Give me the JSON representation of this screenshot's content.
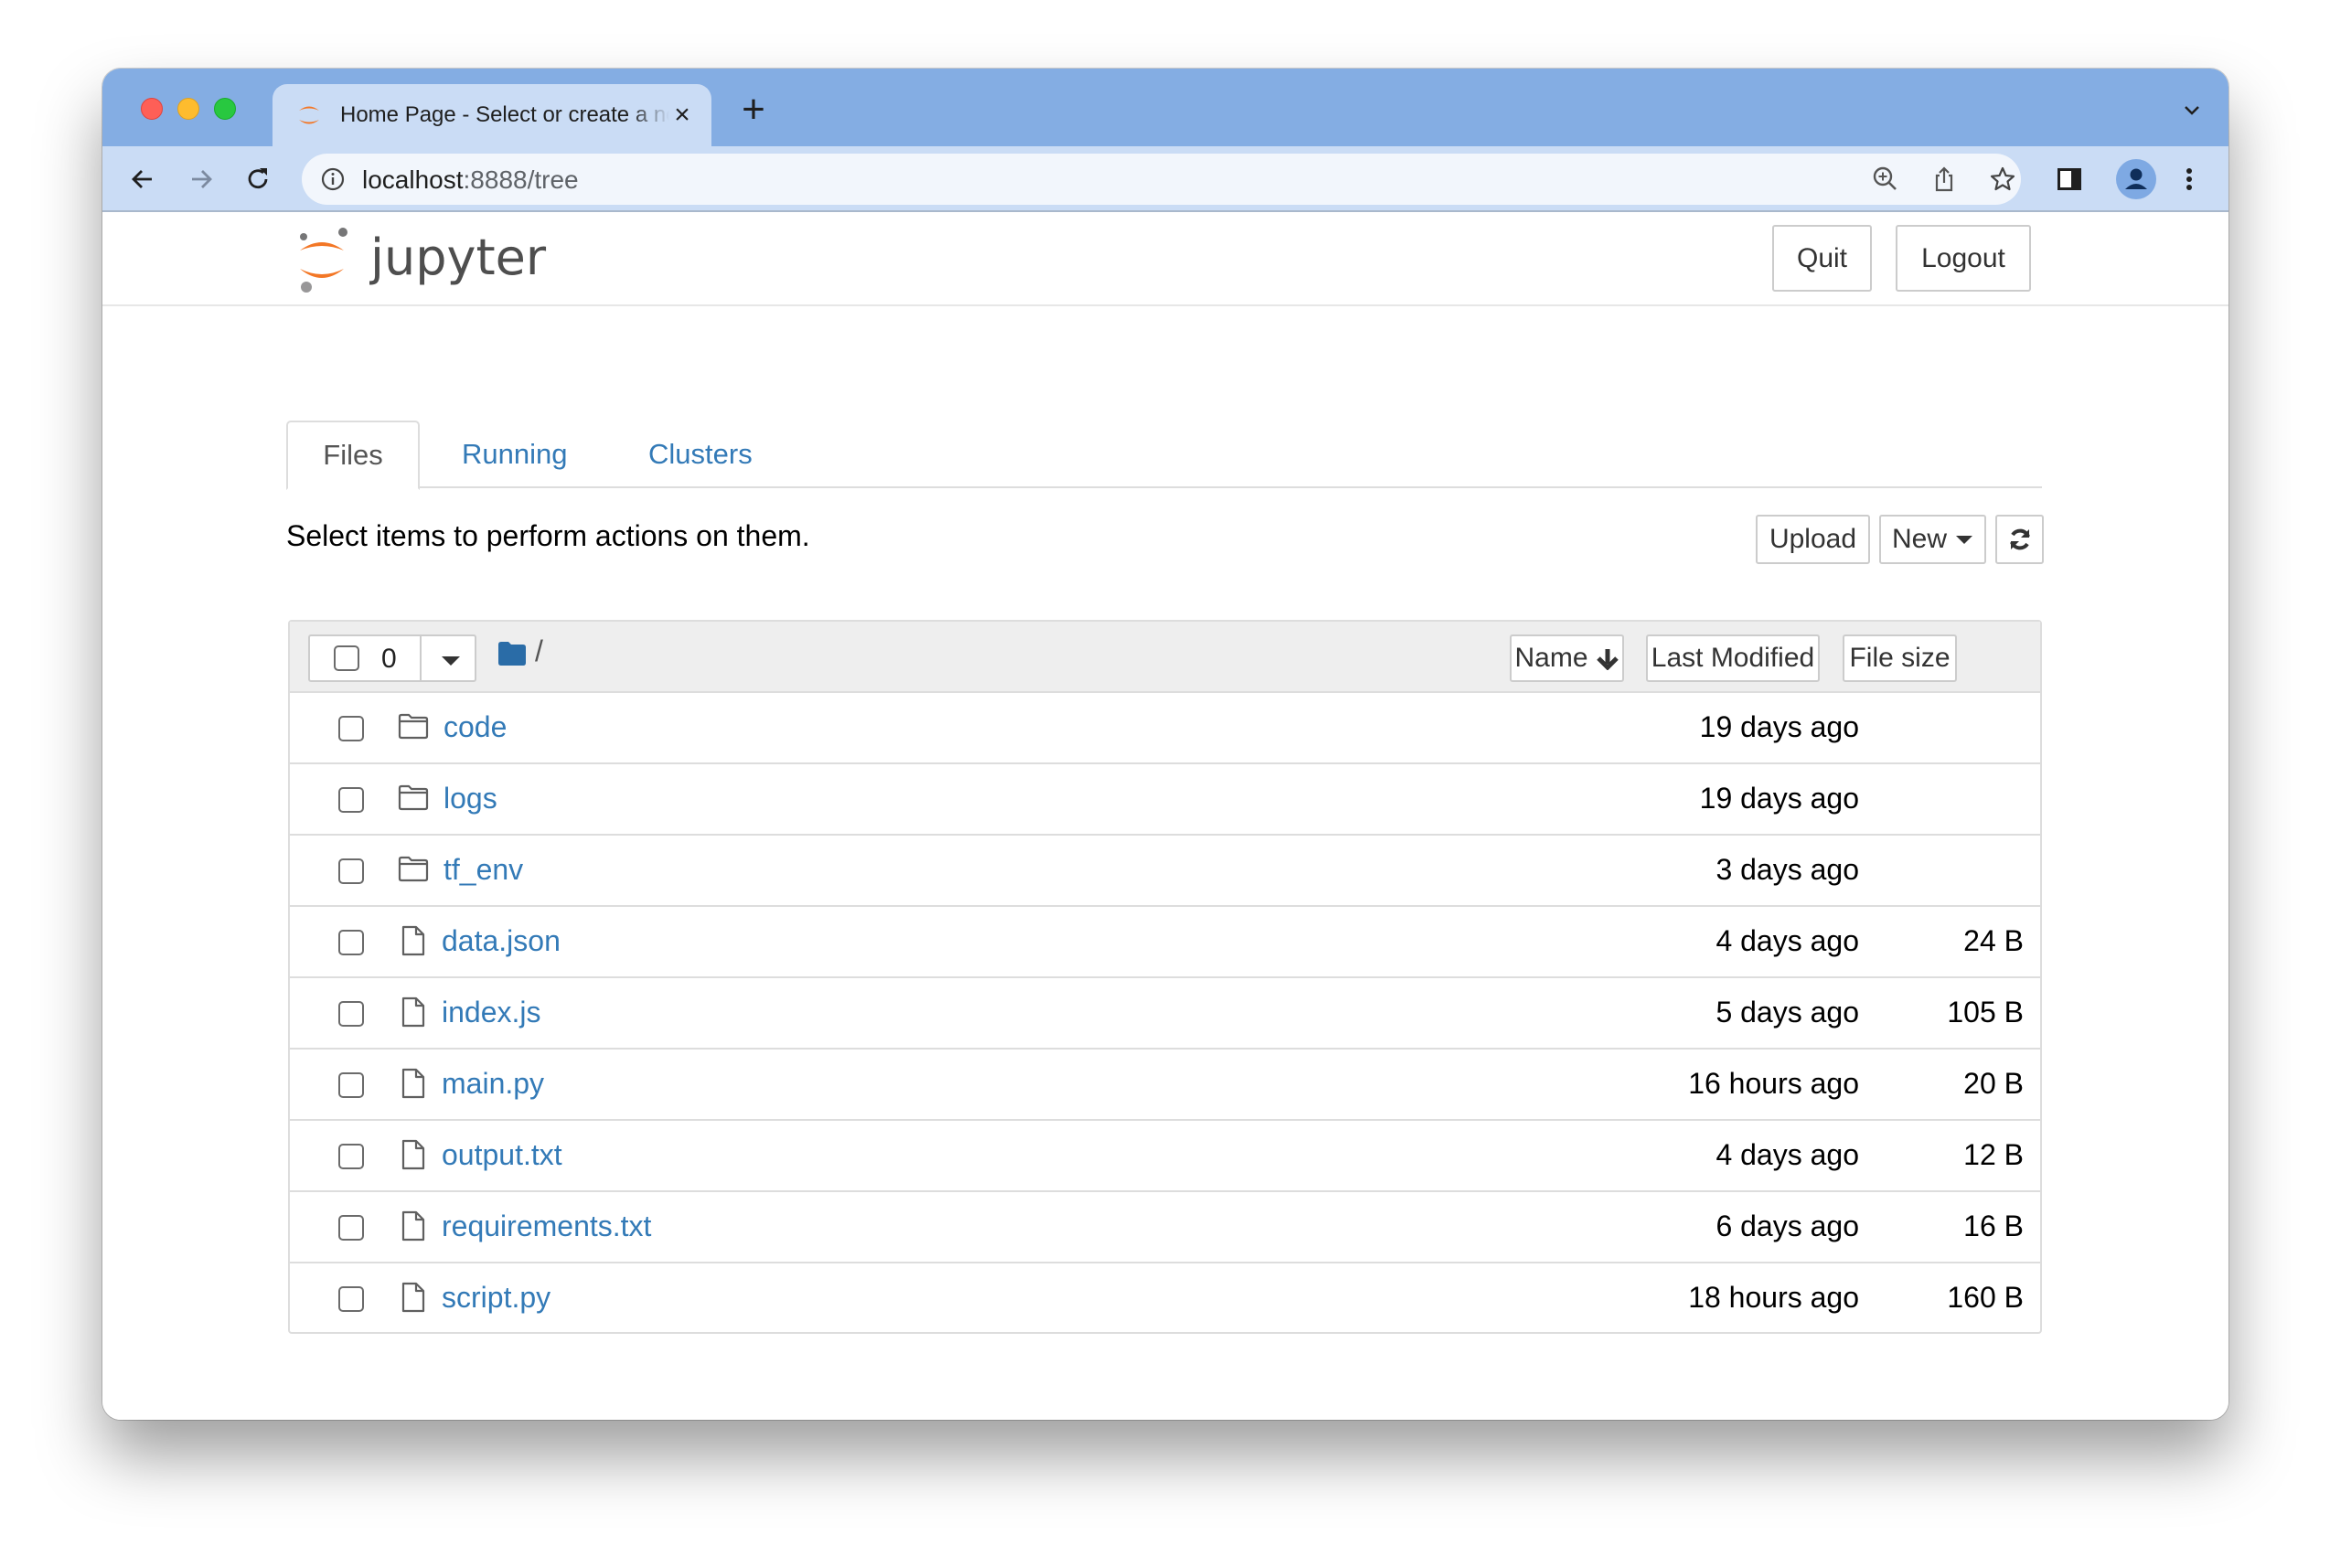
{
  "browser": {
    "tab": {
      "title": "Home Page - Select or create a notebook",
      "favicon": "jupyter-icon"
    },
    "url": {
      "host": "localhost",
      "rest": ":8888/tree"
    },
    "icons": [
      "back-icon",
      "forward-icon",
      "reload-icon",
      "info-icon",
      "zoom-icon",
      "share-icon",
      "bookmark-star-icon",
      "side-panel-icon",
      "profile-avatar-icon",
      "more-menu-icon",
      "tab-list-chevron-icon"
    ]
  },
  "header": {
    "logo_text": "jupyter",
    "quit_label": "Quit",
    "logout_label": "Logout"
  },
  "tabs": [
    {
      "label": "Files",
      "active": true
    },
    {
      "label": "Running",
      "active": false
    },
    {
      "label": "Clusters",
      "active": false
    }
  ],
  "toolbar": {
    "hint": "Select items to perform actions on them.",
    "upload_label": "Upload",
    "new_label": "New",
    "refresh_icon": "refresh-icon"
  },
  "list": {
    "selected_count": "0",
    "breadcrumb": "/",
    "columns": {
      "name": "Name",
      "last_modified": "Last Modified",
      "file_size": "File size"
    },
    "sort": {
      "column": "name",
      "direction": "descending-arrow"
    },
    "items": [
      {
        "name": "code",
        "type": "folder",
        "modified": "19 days ago",
        "size": ""
      },
      {
        "name": "logs",
        "type": "folder",
        "modified": "19 days ago",
        "size": ""
      },
      {
        "name": "tf_env",
        "type": "folder",
        "modified": "3 days ago",
        "size": ""
      },
      {
        "name": "data.json",
        "type": "file",
        "modified": "4 days ago",
        "size": "24 B"
      },
      {
        "name": "index.js",
        "type": "file",
        "modified": "5 days ago",
        "size": "105 B"
      },
      {
        "name": "main.py",
        "type": "file",
        "modified": "16 hours ago",
        "size": "20 B"
      },
      {
        "name": "output.txt",
        "type": "file",
        "modified": "4 days ago",
        "size": "12 B"
      },
      {
        "name": "requirements.txt",
        "type": "file",
        "modified": "6 days ago",
        "size": "16 B"
      },
      {
        "name": "script.py",
        "type": "file",
        "modified": "18 hours ago",
        "size": "160 B"
      }
    ]
  },
  "colors": {
    "link": "#337ab7",
    "jupyter_orange": "#f37726",
    "tabstrip": "#84ade3",
    "toolbar": "#cadcf5"
  }
}
